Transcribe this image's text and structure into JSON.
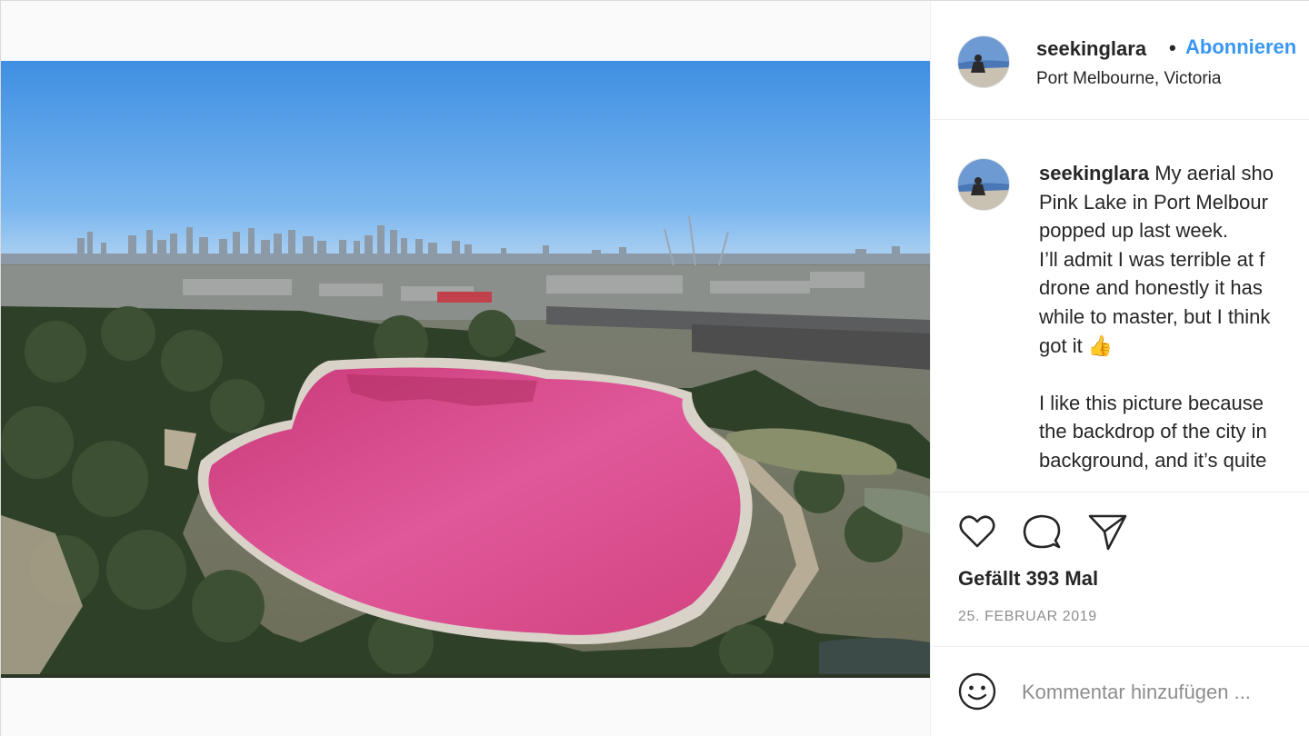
{
  "post": {
    "username": "seekinglara",
    "follow_separator": "•",
    "follow_label": "Abonnieren",
    "location": "Port Melbourne, Victoria"
  },
  "caption": {
    "username": "seekinglara",
    "lines": [
      "My aerial sho",
      "Pink Lake in Port Melbour",
      "popped up last week.",
      "I’ll admit I was terrible at f",
      "drone and honestly it has",
      "while to master, but I think",
      "got it 👍",
      "I like this picture because",
      "the backdrop of the city in",
      "background, and it’s quite"
    ]
  },
  "actions": {
    "like_icon": "heart-icon",
    "comment_icon": "comment-icon",
    "share_icon": "paper-plane-icon"
  },
  "likes_text": "Gefällt 393 Mal",
  "date_text": "25. FEBRUAR 2019",
  "comment_box": {
    "emoji_icon": "smiley-icon",
    "placeholder": "Kommentar hinzufügen ..."
  },
  "colors": {
    "follow": "#3897f0",
    "text": "#262626",
    "muted": "#8e8e8e",
    "border": "#efefef",
    "lake_pink": "#d6457e",
    "sky_blue": "#5fa3e8"
  }
}
